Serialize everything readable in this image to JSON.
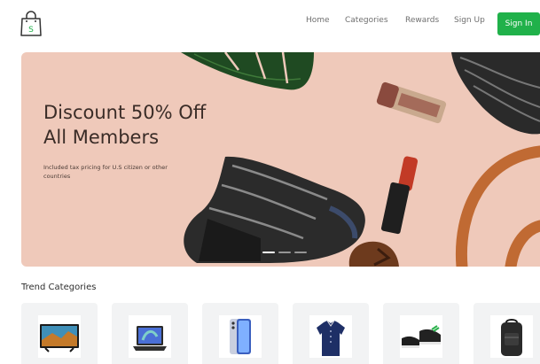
{
  "header": {
    "logo_icon": "shopping-bag-icon",
    "logo_letter": "S",
    "nav": [
      "Home",
      "Categories",
      "Rewards",
      "Sign Up"
    ],
    "signin_label": "Sign In",
    "accent": "#20b14a"
  },
  "hero": {
    "title_line1": "Discount 50% Off",
    "title_line2": "All Members",
    "subtitle": "Included tax pricing for U.S citizen or other countries",
    "background": "#efc9ba",
    "carousel_slides": 3,
    "active_slide": 1
  },
  "trend": {
    "title": "Trend Categories",
    "categories": [
      {
        "icon": "tv-icon"
      },
      {
        "icon": "laptop-icon"
      },
      {
        "icon": "smartphone-icon"
      },
      {
        "icon": "shirt-icon"
      },
      {
        "icon": "sneakers-icon"
      },
      {
        "icon": "backpack-icon"
      }
    ]
  }
}
